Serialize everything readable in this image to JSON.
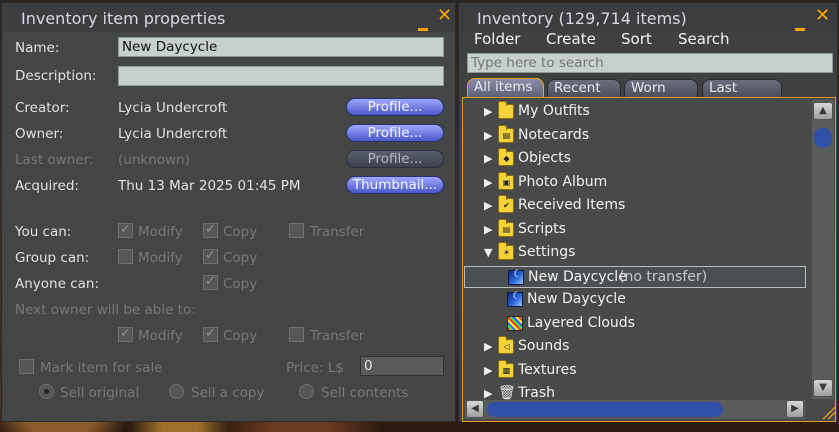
{
  "properties": {
    "title": "Inventory item properties",
    "name_label": "Name:",
    "name_value": "New Daycycle",
    "description_label": "Description:",
    "description_value": "",
    "creator_label": "Creator:",
    "creator_value": "Lycia Undercroft",
    "owner_label": "Owner:",
    "owner_value": "Lycia Undercroft",
    "last_owner_label": "Last owner:",
    "last_owner_value": "(unknown)",
    "acquired_label": "Acquired:",
    "acquired_value": "Thu 13 Mar 2025 01:45 PM",
    "profile_label": "Profile...",
    "thumbnail_label": "Thumbnail...",
    "you_can_label": "You can:",
    "group_can_label": "Group can:",
    "anyone_can_label": "Anyone can:",
    "next_owner_label": "Next owner will be able to:",
    "modify_label": "Modify",
    "copy_label": "Copy",
    "transfer_label": "Transfer",
    "mark_for_sale_label": "Mark item for sale",
    "price_label": "Price: L$",
    "price_value": "0",
    "sell_original_label": "Sell original",
    "sell_copy_label": "Sell a copy",
    "sell_contents_label": "Sell contents",
    "check_mark": "✓"
  },
  "inventory": {
    "title": "Inventory (129,714 items)",
    "menu": [
      "Folder",
      "Create",
      "Sort",
      "Search"
    ],
    "search_placeholder": "Type here to search",
    "tabs": [
      "All items",
      "Recent",
      "Worn",
      "Last open"
    ],
    "active_tab": "All items",
    "items": [
      {
        "label": "My Outfits",
        "suffix": "",
        "type": "folder",
        "glyph": "",
        "expanded": false
      },
      {
        "label": "Notecards",
        "suffix": "",
        "type": "folder",
        "glyph": "▤",
        "expanded": false
      },
      {
        "label": "Objects",
        "suffix": "",
        "type": "folder",
        "glyph": "◆",
        "expanded": false
      },
      {
        "label": "Photo Album",
        "suffix": "",
        "type": "folder",
        "glyph": "▣",
        "expanded": false
      },
      {
        "label": "Received Items",
        "suffix": "",
        "type": "folder",
        "glyph": "✔",
        "expanded": false
      },
      {
        "label": "Scripts",
        "suffix": "",
        "type": "folder",
        "glyph": "▤",
        "expanded": false
      },
      {
        "label": "Settings",
        "suffix": "",
        "type": "folder",
        "glyph": "☀",
        "expanded": true
      },
      {
        "label": "New Daycycle",
        "suffix": "(no transfer)",
        "type": "sky",
        "glyph": "",
        "selected": true
      },
      {
        "label": "New Daycycle",
        "suffix": "",
        "type": "sky",
        "glyph": ""
      },
      {
        "label": "Layered Clouds",
        "suffix": "",
        "type": "cloud",
        "glyph": ""
      },
      {
        "label": "Sounds",
        "suffix": "",
        "type": "folder",
        "glyph": "◁",
        "expanded": false
      },
      {
        "label": "Textures",
        "suffix": "",
        "type": "folder",
        "glyph": "▩",
        "expanded": false
      },
      {
        "label": "Trash",
        "suffix": "",
        "type": "trash",
        "glyph": "🗑",
        "expanded": false
      }
    ]
  },
  "colors": {
    "accent": "#ffa500",
    "button_blue": "#4a58c8",
    "scroll_thumb": "#2f4fa8"
  }
}
